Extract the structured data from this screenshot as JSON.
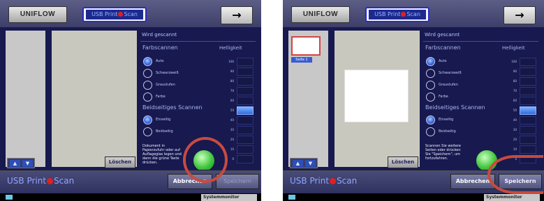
{
  "panels": [
    {
      "logo": "UNIFLOW",
      "mode_prefix": "USB Print",
      "mode_suffix": "Scan",
      "arrow": "→",
      "delete_label": "Löschen",
      "nav_up": "▲",
      "nav_down": "▼",
      "status_title": "Wird gescannt",
      "color_group": "Farbscannen",
      "brightness_label": "Helligkeit",
      "color_options": [
        {
          "label": "Auto",
          "selected": true
        },
        {
          "label": "Schwarzweiß",
          "selected": false
        },
        {
          "label": "Graustufen",
          "selected": false
        },
        {
          "label": "Farbe",
          "selected": false
        }
      ],
      "duplex_group": "Beidseitiges Scannen",
      "duplex_options": [
        {
          "label": "Einseitig",
          "selected": true
        },
        {
          "label": "Beidseitig",
          "selected": false
        }
      ],
      "brightness_levels": [
        "100",
        "90",
        "80",
        "70",
        "60",
        "50",
        "40",
        "30",
        "20",
        "10",
        "0"
      ],
      "brightness_selected": "50",
      "hint": "Dokument in Papierzufuhr oder auf Auflageglas legen und dann die grüne Taste drücken.",
      "brand_prefix": "USB Print",
      "brand_suffix": "Scan",
      "abort_label": "Abbrechen",
      "save_label": "Speichern",
      "save_enabled": false,
      "sysmon": "Systemmonitor",
      "page_label": ""
    },
    {
      "logo": "UNIFLOW",
      "mode_prefix": "USB Print",
      "mode_suffix": "Scan",
      "arrow": "→",
      "delete_label": "Löschen",
      "nav_up": "▲",
      "nav_down": "▼",
      "status_title": "Wird gescannt",
      "color_group": "Farbscannen",
      "brightness_label": "Helligkeit",
      "color_options": [
        {
          "label": "Auto",
          "selected": true
        },
        {
          "label": "Schwarzweiß",
          "selected": false
        },
        {
          "label": "Graustufen",
          "selected": false
        },
        {
          "label": "Farbe",
          "selected": false
        }
      ],
      "duplex_group": "Beidseitiges Scannen",
      "duplex_options": [
        {
          "label": "Einseitig",
          "selected": true
        },
        {
          "label": "Beidseitig",
          "selected": false
        }
      ],
      "brightness_levels": [
        "100",
        "90",
        "80",
        "70",
        "60",
        "50",
        "40",
        "30",
        "20",
        "10",
        "0"
      ],
      "brightness_selected": "50",
      "hint": "Scannen Sie weitere Seiten oder drücken Sie \"Speichern\", um fortzufahren.",
      "brand_prefix": "USB Print",
      "brand_suffix": "Scan",
      "abort_label": "Abbrechen",
      "save_label": "Speichern",
      "save_enabled": true,
      "sysmon": "Systemmonitor",
      "page_label": "Seite 1"
    }
  ],
  "colors": {
    "background": "#17194f",
    "highlight_ring": "#c84a3f",
    "go_button": "#41c63b",
    "radio_selected": "#2f62d8"
  },
  "icons": [
    "arrow-right-icon",
    "scan-dot-icon",
    "radio-icon",
    "go-button-icon",
    "monitor-icon"
  ]
}
